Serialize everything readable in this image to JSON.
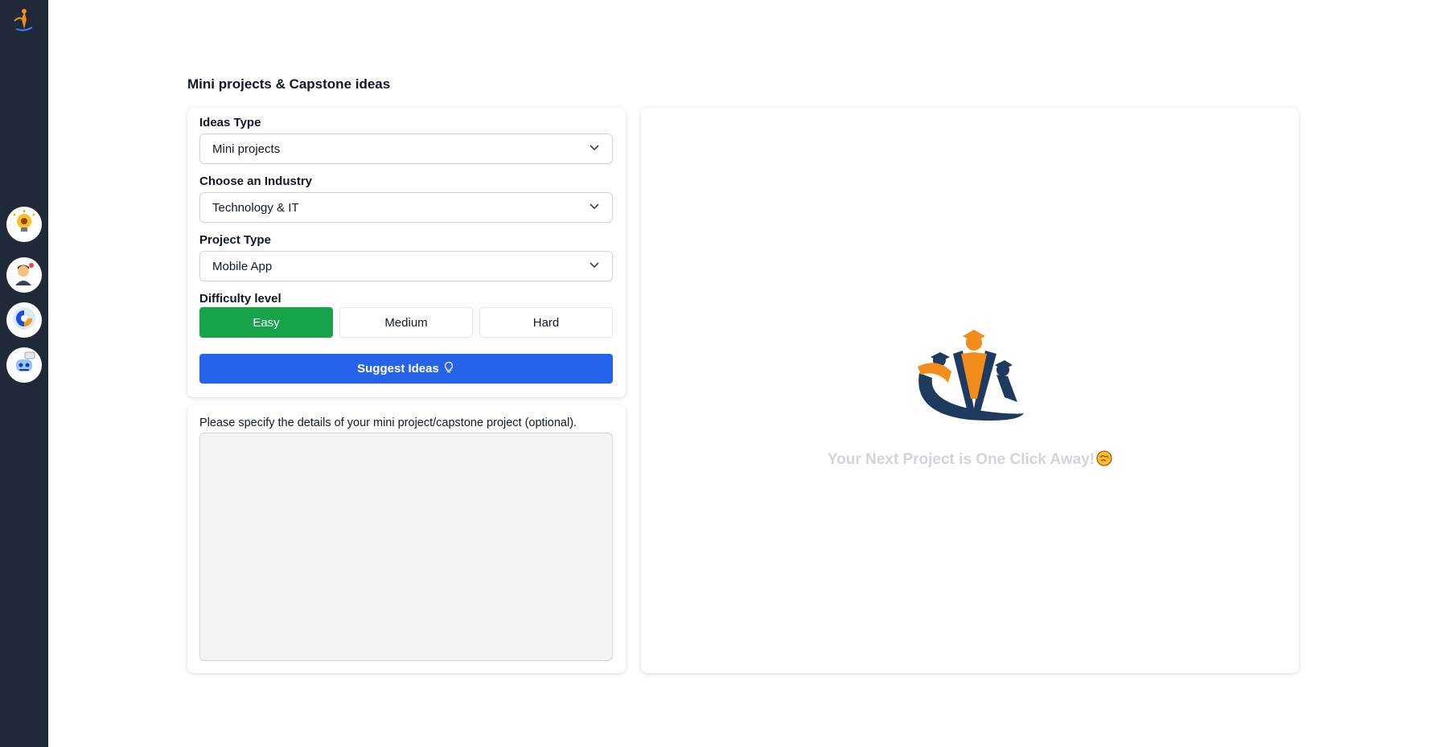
{
  "page": {
    "title": "Mini projects & Capstone ideas"
  },
  "sidebar": {
    "items": [
      {
        "icon": "lightbulb-icon"
      },
      {
        "icon": "avatar-icon"
      },
      {
        "icon": "compass-icon"
      },
      {
        "icon": "robot-icon"
      }
    ]
  },
  "form": {
    "ideas_type": {
      "label": "Ideas Type",
      "value": "Mini projects"
    },
    "industry": {
      "label": "Choose an Industry",
      "value": "Technology & IT"
    },
    "project_type": {
      "label": "Project Type",
      "value": "Mobile App"
    },
    "difficulty": {
      "label": "Difficulty level",
      "options": [
        "Easy",
        "Medium",
        "Hard"
      ],
      "selected": "Easy"
    },
    "suggest_label": "Suggest Ideas"
  },
  "details": {
    "label": "Please specify the details of your mini project/capstone project (optional).",
    "value": ""
  },
  "preview": {
    "message": "Your Next Project is One Click Away!"
  },
  "colors": {
    "sidebar": "#1f2937",
    "accent_blue": "#2563eb",
    "active_green": "#16a34a",
    "logo_navy": "#1e3a5f",
    "logo_orange": "#f28c1b"
  }
}
